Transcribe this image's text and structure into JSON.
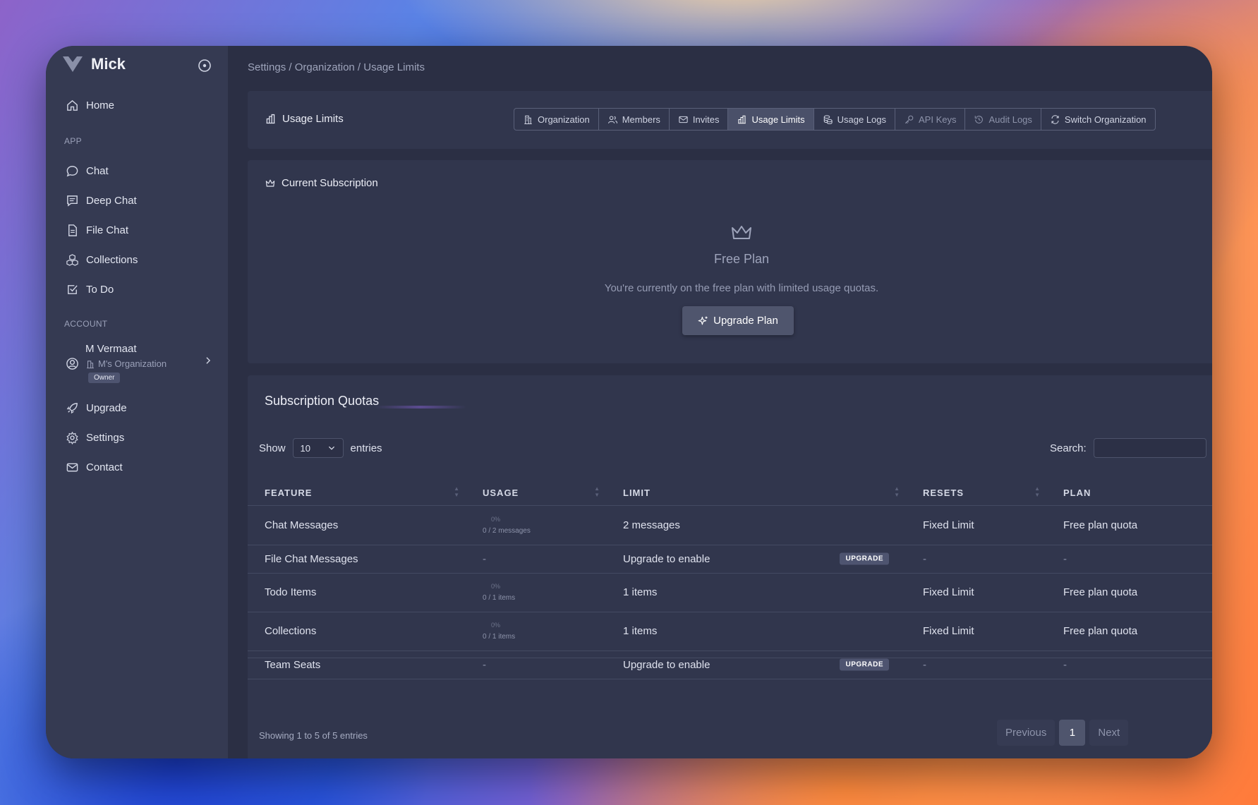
{
  "app": {
    "name": "Mick"
  },
  "sidebar": {
    "home": "Home",
    "section_app": "APP",
    "app_items": [
      "Chat",
      "Deep Chat",
      "File Chat",
      "Collections",
      "To Do"
    ],
    "section_account": "ACCOUNT",
    "account": {
      "name": "M Vermaat",
      "org": "M's Organization",
      "role": "Owner"
    },
    "account_items": [
      "Upgrade",
      "Settings",
      "Contact"
    ]
  },
  "breadcrumb": "Settings / Organization / Usage Limits",
  "header": {
    "title": "Usage Limits",
    "tabs": [
      "Organization",
      "Members",
      "Invites",
      "Usage Limits",
      "Usage Logs",
      "API Keys",
      "Audit Logs",
      "Switch Organization"
    ],
    "active_tab": "Usage Limits"
  },
  "subscription": {
    "title": "Current Subscription",
    "plan_name": "Free Plan",
    "description": "You're currently on the free plan with limited usage quotas.",
    "upgrade_label": "Upgrade Plan"
  },
  "quotas": {
    "title": "Subscription Quotas",
    "show_label": "Show",
    "entries_value": "10",
    "entries_label": "entries",
    "search_label": "Search:",
    "columns": [
      "FEATURE",
      "USAGE",
      "LIMIT",
      "RESETS",
      "PLAN"
    ],
    "rows": [
      {
        "feature": "Chat Messages",
        "pct": "0%",
        "usage": "0 / 2 messages",
        "limit": "2 messages",
        "badge": "",
        "resets": "Fixed Limit",
        "plan": "Free plan quota"
      },
      {
        "feature": "File Chat Messages",
        "pct": "",
        "usage": "-",
        "limit": "Upgrade to enable",
        "badge": "UPGRADE",
        "resets": "-",
        "plan": "-"
      },
      {
        "feature": "Todo Items",
        "pct": "0%",
        "usage": "0 / 1 items",
        "limit": "1 items",
        "badge": "",
        "resets": "Fixed Limit",
        "plan": "Free plan quota"
      },
      {
        "feature": "Collections",
        "pct": "0%",
        "usage": "0 / 1 items",
        "limit": "1 items",
        "badge": "",
        "resets": "Fixed Limit",
        "plan": "Free plan quota"
      },
      {
        "feature": "Team Seats",
        "pct": "",
        "usage": "-",
        "limit": "Upgrade to enable",
        "badge": "UPGRADE",
        "resets": "-",
        "plan": "-"
      }
    ],
    "info": "Showing 1 to 5 of 5 entries",
    "pager": {
      "previous": "Previous",
      "current": "1",
      "next": "Next"
    }
  }
}
